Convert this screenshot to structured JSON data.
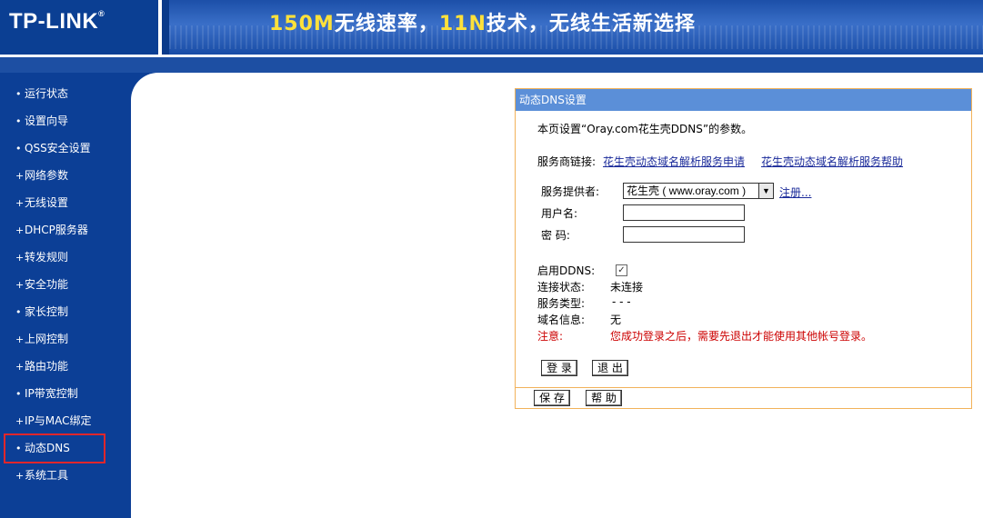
{
  "header": {
    "logo": "TP-LINK",
    "logo_reg": "®",
    "banner_part1": "150M",
    "banner_part2": "无线速率，",
    "banner_part3": "11N",
    "banner_part4": "技术，无线生活新选择",
    "highlight_color": "#ffe13a"
  },
  "sidebar": {
    "items": [
      {
        "bullet": "•",
        "label": "运行状态"
      },
      {
        "bullet": "•",
        "label": "设置向导"
      },
      {
        "bullet": "•",
        "label": "QSS安全设置"
      },
      {
        "bullet": "+",
        "label": "网络参数"
      },
      {
        "bullet": "+",
        "label": "无线设置"
      },
      {
        "bullet": "+",
        "label": "DHCP服务器"
      },
      {
        "bullet": "+",
        "label": "转发规则"
      },
      {
        "bullet": "+",
        "label": "安全功能"
      },
      {
        "bullet": "•",
        "label": "家长控制"
      },
      {
        "bullet": "+",
        "label": "上网控制"
      },
      {
        "bullet": "+",
        "label": "路由功能"
      },
      {
        "bullet": "•",
        "label": "IP带宽控制"
      },
      {
        "bullet": "+",
        "label": "IP与MAC绑定"
      },
      {
        "bullet": "•",
        "label": "动态DNS"
      },
      {
        "bullet": "+",
        "label": "系统工具"
      }
    ],
    "selected": "动态DNS",
    "highlight_color": "#e0262b"
  },
  "panel": {
    "title": "动态DNS设置",
    "intro": "本页设置“Oray.com花生壳DDNS”的参数。",
    "provider_links_label": "服务商链接:",
    "link1": "花生壳动态域名解析服务申请",
    "link2": "花生壳动态域名解析服务帮助",
    "provider_label": "服务提供者:",
    "provider_value": "花生壳 ( www.oray.com )",
    "register_link": "注册...",
    "username_label": "用户名:",
    "username_value": "",
    "password_label": "密  码:",
    "password_value": "",
    "enable_label": "启用DDNS:",
    "enable_checked": "✓",
    "status_label": "连接状态:",
    "status_value": "未连接",
    "service_type_label": "服务类型:",
    "service_type_value": "- - -",
    "domain_label": "域名信息:",
    "domain_value": "无",
    "note_label": "注意:",
    "note_value": "您成功登录之后，需要先退出才能使用其他帐号登录。",
    "login_button": "登 录",
    "logout_button": "退 出",
    "save_button": "保 存",
    "help_button": "帮 助"
  }
}
